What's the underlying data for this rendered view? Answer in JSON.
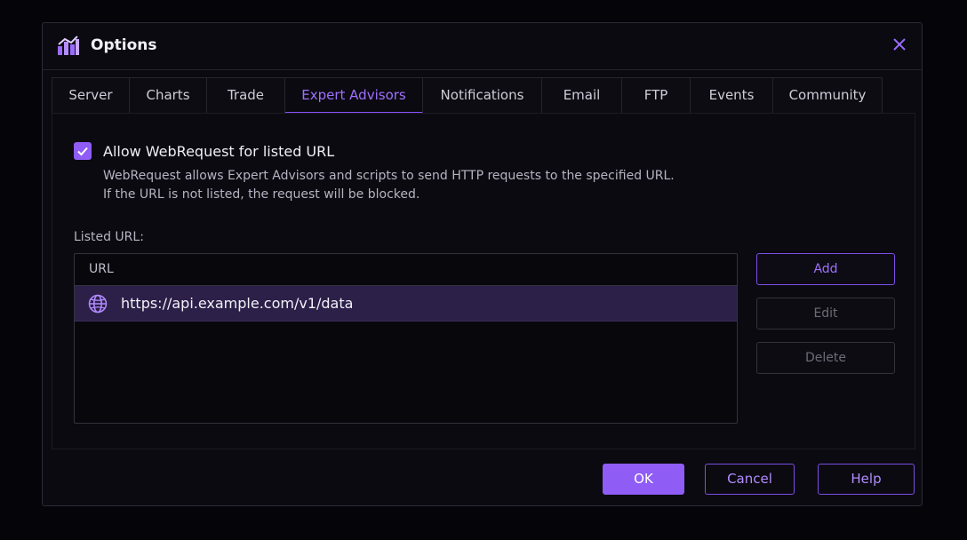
{
  "window": {
    "title": "Options",
    "accent_color": "#8f5cf6",
    "app_icon": "chart-app-icon",
    "close_icon": "close-icon"
  },
  "tabs": [
    {
      "label": "Server",
      "active": false
    },
    {
      "label": "Charts",
      "active": false
    },
    {
      "label": "Trade",
      "active": false
    },
    {
      "label": "Expert Advisors",
      "active": true
    },
    {
      "label": "Notifications",
      "active": false
    },
    {
      "label": "Email",
      "active": false
    },
    {
      "label": "FTP",
      "active": false
    },
    {
      "label": "Events",
      "active": false
    },
    {
      "label": "Community",
      "active": false
    }
  ],
  "webrequest": {
    "checked": true,
    "label": "Allow WebRequest for listed URL",
    "description_line1": "WebRequest allows Expert Advisors and scripts to send HTTP requests to the specified URL.",
    "description_line2": "If the URL is not listed, the request will be blocked."
  },
  "url_list": {
    "label": "Listed URL:",
    "column_header": "URL",
    "rows": [
      {
        "icon": "globe-icon",
        "url": "https://api.example.com/v1/data",
        "selected": true
      }
    ]
  },
  "side_buttons": {
    "add": "Add",
    "edit": "Edit",
    "delete": "Delete"
  },
  "footer": {
    "ok": "OK",
    "cancel": "Cancel",
    "help": "Help"
  }
}
